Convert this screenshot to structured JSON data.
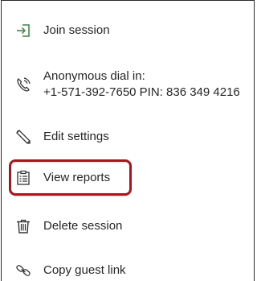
{
  "menu": {
    "join_session": "Join session",
    "dial_in_title": "Anonymous dial in:",
    "dial_in_number": "+1-571-392-7650 PIN: 836 349 4216",
    "edit_settings": "Edit settings",
    "view_reports": "View reports",
    "delete_session": "Delete session",
    "copy_guest_link": "Copy guest link"
  },
  "colors": {
    "icon_green": "#2e8b3a",
    "highlight": "#b0121b"
  },
  "icons": {
    "join_session": "enter-icon",
    "dial_in": "phone-icon",
    "edit_settings": "pencil-icon",
    "view_reports": "report-icon",
    "delete_session": "trash-icon",
    "copy_guest_link": "link-icon"
  }
}
